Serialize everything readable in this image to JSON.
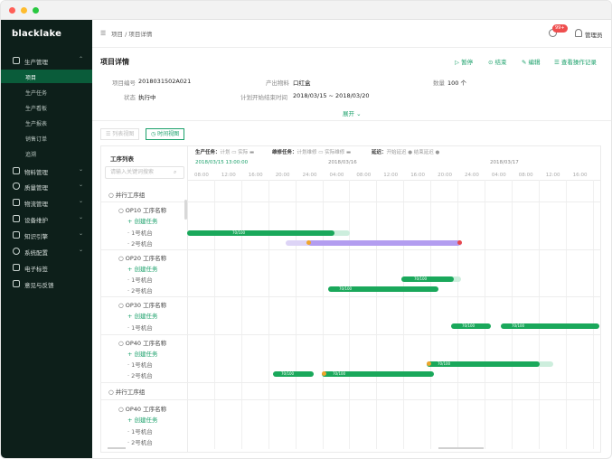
{
  "app": {
    "brand": "blacklake"
  },
  "sidebar": {
    "items": [
      {
        "label": "生产管理",
        "icon": "factory-icon",
        "expanded": true
      },
      {
        "label": "物料管理",
        "icon": "box-icon"
      },
      {
        "label": "质量管理",
        "icon": "shield-icon"
      },
      {
        "label": "物流管理",
        "icon": "truck-icon"
      },
      {
        "label": "设备维护",
        "icon": "wrench-icon"
      },
      {
        "label": "知识引擎",
        "icon": "book-icon"
      },
      {
        "label": "系统配置",
        "icon": "gear-icon"
      },
      {
        "label": "电子标签",
        "icon": "tag-icon"
      },
      {
        "label": "意见与反馈",
        "icon": "mail-icon"
      }
    ],
    "sub_items": [
      "项目",
      "生产任务",
      "生产看板",
      "生产报表",
      "销售订单",
      "追溯"
    ],
    "active_sub": "项目"
  },
  "header": {
    "breadcrumb": "项目 / 项目详情",
    "badge": "99+",
    "user": "管理员"
  },
  "detail": {
    "title": "项目详情",
    "actions": [
      "▷ 暂停",
      "⊙ 结束",
      "✎ 编辑",
      "☰ 查看操作记录"
    ],
    "fields": {
      "code_label": "项目编号",
      "code_value": "2018031502A021",
      "product_label": "产出物料",
      "product_value": "口红盒",
      "qty_label": "数量",
      "qty_value": "100 个",
      "status_label": "状态",
      "status_value": "执行中",
      "plan_label": "计划开始结束时间",
      "plan_value": "2018/03/15 ~ 2018/03/20"
    },
    "expand": "展开 ⌄"
  },
  "views": {
    "list": "☰ 列表视图",
    "timeline": "◷ 时间视图"
  },
  "gantt": {
    "tree_title": "工序列表",
    "search_placeholder": "请输入关键词搜索",
    "legend": {
      "prod_label": "生产任务：",
      "prod_items": "计划 ▭  实际 ▬",
      "maint_label": "维修任务：",
      "maint_items": "计划维修 ▭  实际维修 ▬",
      "status_label": "延迟：",
      "status_items": "开始延迟 ●  结束延迟 ●"
    },
    "dates": [
      "2018/03/15 13:00:00",
      "2018/03/16",
      "2018/03/17"
    ],
    "hours": [
      "08:00",
      "12:00",
      "16:00",
      "20:00",
      "24:00",
      "04:00",
      "08:00",
      "12:00",
      "16:00",
      "20:00",
      "24:00",
      "04:00",
      "08:00",
      "12:00",
      "16:00"
    ],
    "tree": [
      {
        "text": "○  并行工序组",
        "kind": "group"
      },
      {
        "text": "○  OP10 工序名称",
        "kind": "op"
      },
      {
        "text": "+  创建任务",
        "kind": "create"
      },
      {
        "text": "· 1号机台",
        "kind": "machine"
      },
      {
        "text": "· 2号机台",
        "kind": "machine"
      },
      {
        "text": "○  OP20 工序名称",
        "kind": "op"
      },
      {
        "text": "+  创建任务",
        "kind": "create"
      },
      {
        "text": "· 1号机台",
        "kind": "machine"
      },
      {
        "text": "· 2号机台",
        "kind": "machine"
      },
      {
        "text": "○  OP30 工序名称",
        "kind": "op"
      },
      {
        "text": "+  创建任务",
        "kind": "create"
      },
      {
        "text": "· 1号机台",
        "kind": "machine"
      },
      {
        "text": "○  OP40 工序名称",
        "kind": "op"
      },
      {
        "text": "+  创建任务",
        "kind": "create"
      },
      {
        "text": "· 1号机台",
        "kind": "machine"
      },
      {
        "text": "· 2号机台",
        "kind": "machine"
      },
      {
        "text": "○  并行工序组",
        "kind": "group"
      },
      {
        "text": "○  OP40 工序名称",
        "kind": "op"
      },
      {
        "text": "+  创建任务",
        "kind": "create"
      },
      {
        "text": "· 1号机台",
        "kind": "machine"
      },
      {
        "text": "· 2号机台",
        "kind": "machine"
      }
    ],
    "bar_labels": [
      "70/100",
      "70/100",
      "70/100",
      "70/100",
      "70/100",
      "70/100",
      "70/100",
      "70/100"
    ],
    "colors": {
      "prod": "#1aa85b",
      "maint": "#b39df0",
      "start_delay": "#f0a52c",
      "end_delay": "#e8484e"
    }
  }
}
